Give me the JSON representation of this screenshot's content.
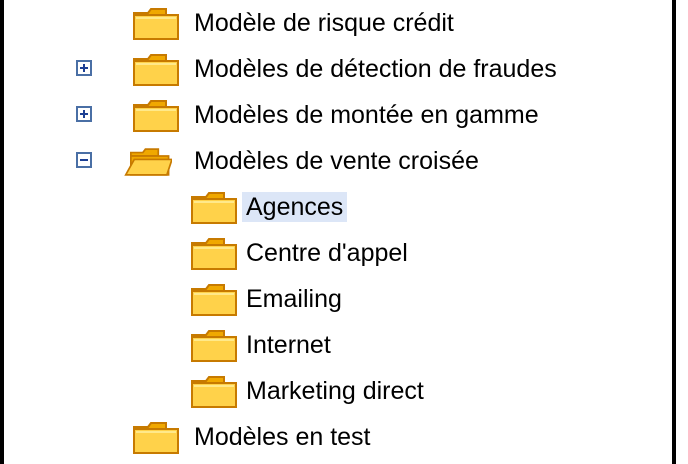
{
  "tree": {
    "items": [
      {
        "label": "Modèle de risque crédit",
        "expander": "none"
      },
      {
        "label": "Modèles de détection de fraudes",
        "expander": "plus"
      },
      {
        "label": "Modèles de montée en gamme",
        "expander": "plus"
      },
      {
        "label": "Modèles de vente croisée",
        "expander": "minus",
        "open": true,
        "children": [
          {
            "label": "Agences",
            "selected": true
          },
          {
            "label": "Centre d'appel"
          },
          {
            "label": "Emailing"
          },
          {
            "label": "Internet"
          },
          {
            "label": "Marketing direct"
          }
        ]
      },
      {
        "label": "Modèles en test",
        "expander": "none"
      }
    ]
  },
  "colors": {
    "folder_fill": "#ffd24a",
    "folder_shade": "#f0a800",
    "folder_edge": "#c77a00",
    "selection": "#dce6f7",
    "expander_border": "#4a6fa5"
  }
}
